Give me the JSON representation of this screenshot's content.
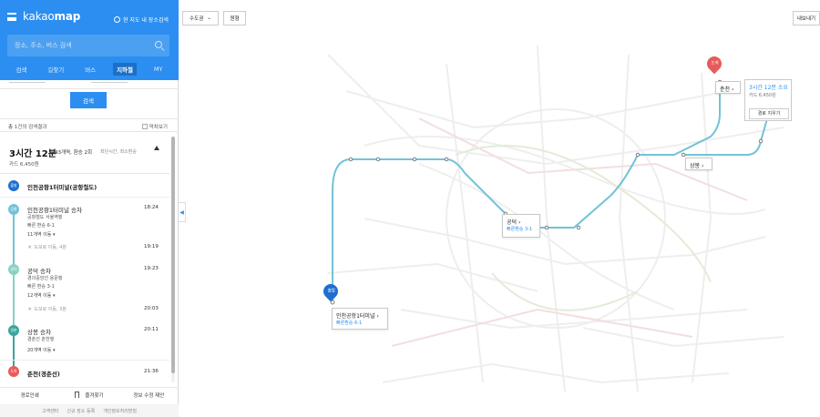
{
  "header": {
    "logo_light": "kakao",
    "logo_bold": "map",
    "map_search_label": "현 지도 내 장소검색",
    "search_placeholder": "장소, 주소, 버스 검색",
    "tabs": [
      "검색",
      "길찾기",
      "버스",
      "지하철",
      "MY"
    ],
    "active_tab": "지하철"
  },
  "search_button": "검색",
  "results": {
    "count_text": "총 1건의 검색결과",
    "option_label": "막차보기"
  },
  "route": {
    "duration": "3시간 12분",
    "meta": "43개역, 환승 2회",
    "sub_meta": "최단시간, 최소환승",
    "fare": "카드 6,450원",
    "start": {
      "badge": "출발",
      "name": "인천공항1터미널(공항철도)"
    },
    "segments": [
      {
        "badge": "공항",
        "title": "인천공항1터미널 승차",
        "time": "18:24",
        "line": "공항철도 서울역행",
        "note": "빠른 환승 6-1",
        "stops": "11개역 이동",
        "walk": "도보로 이동, 4분",
        "arrive": "19:19",
        "color": "#73c3d6"
      },
      {
        "badge": "경의",
        "title": "공덕 승차",
        "time": "19:23",
        "line": "경의중앙선 용문행",
        "note": "빠른 환승 3-1",
        "stops": "12개역 이동",
        "walk": "도보로 이동, 3분",
        "arrive": "20:03",
        "color": "#7fcbc0"
      },
      {
        "badge": "경춘",
        "title": "상봉 승차",
        "time": "20:11",
        "line": "경춘선 춘천행",
        "note": "",
        "stops": "20개역 이동",
        "walk": "",
        "arrive": "",
        "color": "#3aa59b"
      }
    ],
    "end": {
      "badge": "도착",
      "name": "춘천(경춘선)",
      "time": "21:36"
    }
  },
  "bottom_actions": [
    "경로인쇄",
    "즐겨찾기",
    "정보 수정 제안"
  ],
  "footer_links": [
    "고객센터",
    "신규 장소 등록",
    "개인정보처리방침"
  ],
  "map_controls": {
    "region": "수도권",
    "reset": "원형",
    "export": "내보내기"
  },
  "map_labels": {
    "start_pin": "출발",
    "end_pin": "도착",
    "start_station": "인천공항1터미널",
    "start_sub": "빠른환승 6-1",
    "transfer1": "공덕",
    "transfer1_sub": "빠른환승 3-1",
    "transfer2": "상봉",
    "end_station": "춘천",
    "summary_time": "3시간 12분 소요",
    "summary_fare": "카드 6,450원",
    "summary_clear": "경로 지우기"
  },
  "colors": {
    "brand": "#2b8ef0",
    "route_line": "#73c3d6",
    "start_pin": "#1f6fd0",
    "end_pin": "#e85b5b"
  }
}
